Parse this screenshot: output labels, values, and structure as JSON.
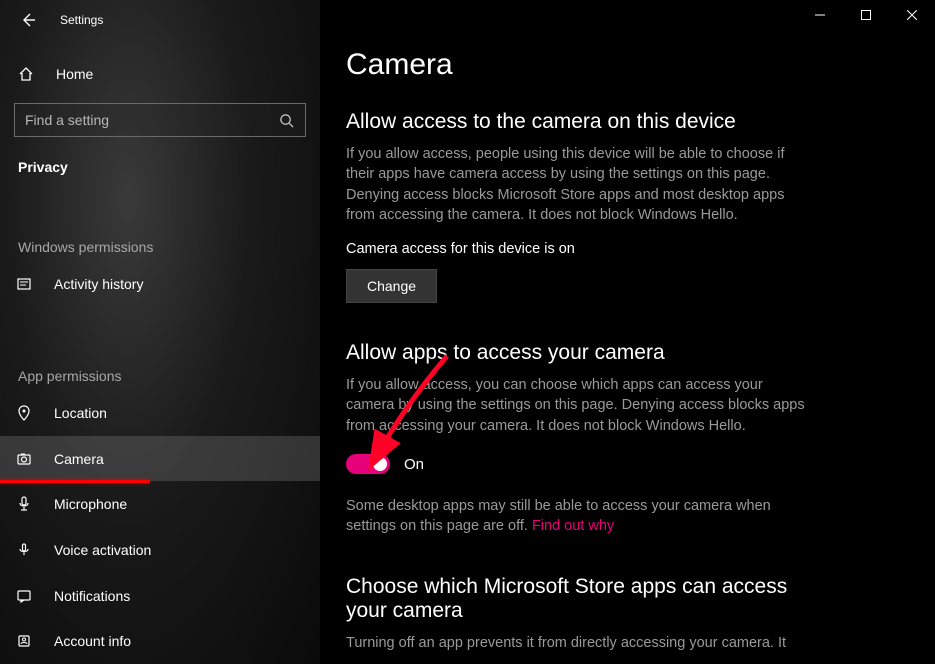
{
  "titlebar": {
    "label": "Settings"
  },
  "home": {
    "label": "Home"
  },
  "search": {
    "placeholder": "Find a setting"
  },
  "privacy": {
    "label": "Privacy"
  },
  "section_windows": {
    "label": "Windows permissions"
  },
  "section_app": {
    "label": "App permissions"
  },
  "nav": {
    "activity": {
      "label": "Activity history"
    },
    "location": {
      "label": "Location"
    },
    "camera": {
      "label": "Camera"
    },
    "microphone": {
      "label": "Microphone"
    },
    "voice": {
      "label": "Voice activation"
    },
    "notifications": {
      "label": "Notifications"
    },
    "account": {
      "label": "Account info"
    }
  },
  "page": {
    "title": "Camera",
    "s1": {
      "title": "Allow access to the camera on this device",
      "body": "If you allow access, people using this device will be able to choose if their apps have camera access by using the settings on this page. Denying access blocks Microsoft Store apps and most desktop apps from accessing the camera. It does not block Windows Hello.",
      "status": "Camera access for this device is on",
      "button": "Change"
    },
    "s2": {
      "title": "Allow apps to access your camera",
      "body": "If you allow access, you can choose which apps can access your camera by using the settings on this page. Denying access blocks apps from accessing your camera. It does not block Windows Hello.",
      "toggle_state": "On",
      "note_a": "Some desktop apps may still be able to access your camera when settings on this page are off. ",
      "note_link": "Find out why"
    },
    "s3": {
      "title": "Choose which Microsoft Store apps can access your camera",
      "body": "Turning off an app prevents it from directly accessing your camera. It"
    }
  }
}
